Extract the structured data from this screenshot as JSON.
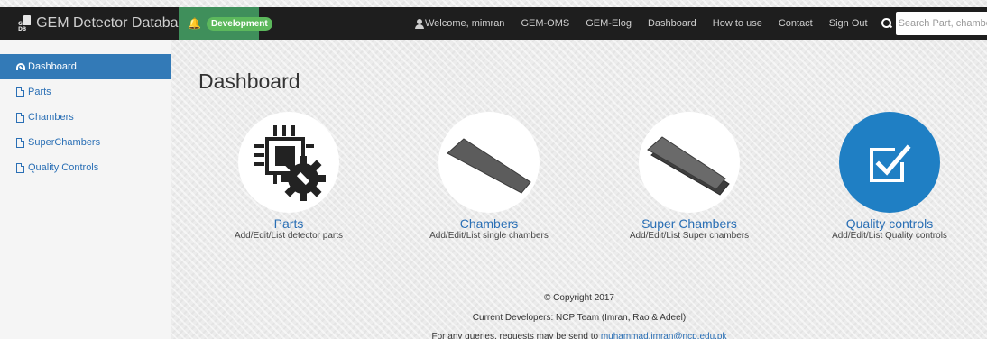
{
  "brand": {
    "logo_text": "GEM DB",
    "title": "GEM Detector Database"
  },
  "environment": {
    "badge": "Development"
  },
  "nav": {
    "welcome": "Welcome, mimran",
    "links": [
      "GEM-OMS",
      "GEM-Elog",
      "Dashboard",
      "How to use",
      "Contact",
      "Sign Out"
    ]
  },
  "search": {
    "placeholder": "Search Part, chamber Or s-chamber"
  },
  "sidebar": {
    "items": [
      {
        "label": "Dashboard",
        "icon": "dashboard-icon"
      },
      {
        "label": "Parts",
        "icon": "file-icon"
      },
      {
        "label": "Chambers",
        "icon": "file-icon"
      },
      {
        "label": "SuperChambers",
        "icon": "file-icon"
      },
      {
        "label": "Quality Controls",
        "icon": "file-icon"
      }
    ]
  },
  "main": {
    "title": "Dashboard",
    "cards": [
      {
        "title": "Parts",
        "description": "Add/Edit/List detector parts",
        "icon": "chip-gear-icon"
      },
      {
        "title": "Chambers",
        "description": "Add/Edit/List single chambers",
        "icon": "chamber-icon"
      },
      {
        "title": "Super Chambers",
        "description": "Add/Edit/List Super chambers",
        "icon": "super-chamber-icon"
      },
      {
        "title": "Quality controls",
        "description": "Add/Edit/List Quality controls",
        "icon": "checkbox-icon"
      }
    ]
  },
  "footer": {
    "copyright": "© Copyright 2017",
    "developers": "Current Developers: NCP Team (Imran, Rao & Adeel)",
    "queries_prefix": "For any queries, requests may be send to ",
    "email": "muhammad.imran@ncp.edu.pk"
  },
  "colors": {
    "topbar": "#1e1e1e",
    "environment": "#3f8f5b",
    "badge": "#5cb85c",
    "link": "#2a6fb5",
    "active": "#337ab7",
    "qc_circle": "#1f7fc4"
  }
}
